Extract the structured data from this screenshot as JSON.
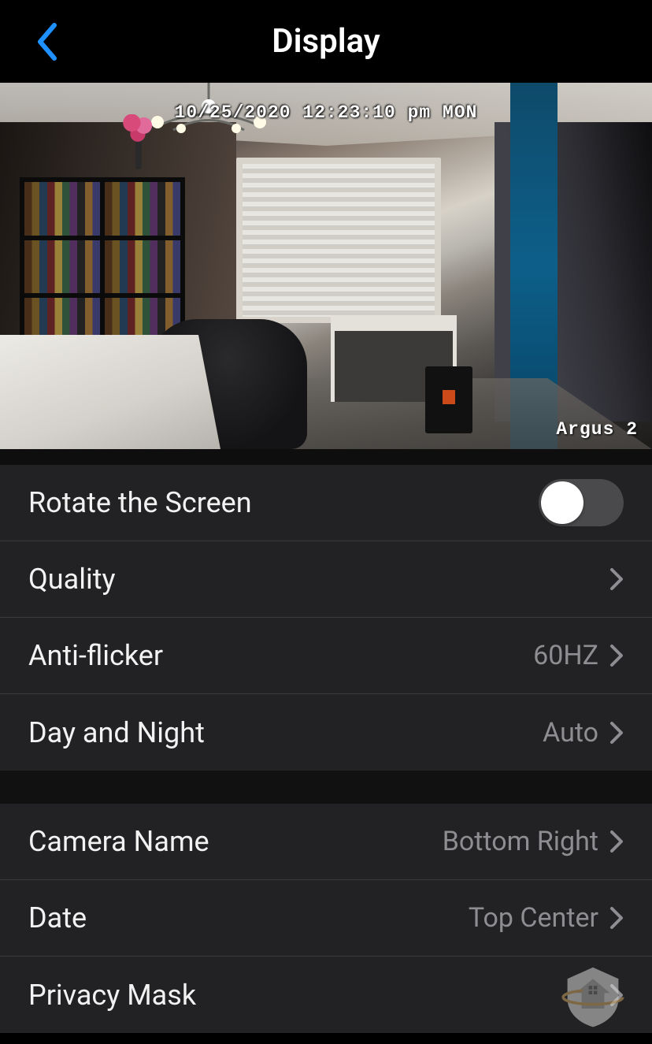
{
  "header": {
    "title": "Display"
  },
  "preview": {
    "timestamp_overlay": "10/25/2020 12:23:10 pm MON",
    "camera_name_overlay": "Argus 2"
  },
  "settings": {
    "group1": [
      {
        "key": "rotate",
        "label": "Rotate the Screen",
        "type": "toggle",
        "value_on": false
      },
      {
        "key": "quality",
        "label": "Quality",
        "type": "link",
        "value": ""
      },
      {
        "key": "antiflicker",
        "label": "Anti-flicker",
        "type": "link",
        "value": "60HZ"
      },
      {
        "key": "daynight",
        "label": "Day and Night",
        "type": "link",
        "value": "Auto"
      }
    ],
    "group2": [
      {
        "key": "cameraname",
        "label": "Camera Name",
        "type": "link",
        "value": "Bottom Right"
      },
      {
        "key": "date",
        "label": "Date",
        "type": "link",
        "value": "Top Center"
      },
      {
        "key": "privacymask",
        "label": "Privacy Mask",
        "type": "link",
        "value": ""
      }
    ]
  }
}
